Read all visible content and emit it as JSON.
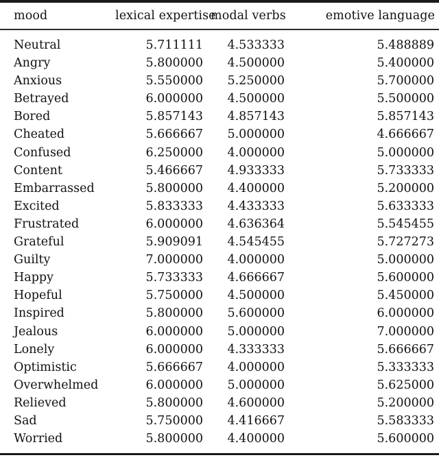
{
  "table": {
    "columns": [
      {
        "key": "mood",
        "label": "mood",
        "align": "left"
      },
      {
        "key": "lexical",
        "label": "lexical expertise",
        "align": "right"
      },
      {
        "key": "modal",
        "label": "modal verbs",
        "align": "right"
      },
      {
        "key": "emotive",
        "label": "emotive language",
        "align": "right"
      }
    ],
    "rows": [
      {
        "mood": "Neutral",
        "lexical": "5.711111",
        "modal": "4.533333",
        "emotive": "5.488889"
      },
      {
        "mood": "Angry",
        "lexical": "5.800000",
        "modal": "4.500000",
        "emotive": "5.400000"
      },
      {
        "mood": "Anxious",
        "lexical": "5.550000",
        "modal": "5.250000",
        "emotive": "5.700000"
      },
      {
        "mood": "Betrayed",
        "lexical": "6.000000",
        "modal": "4.500000",
        "emotive": "5.500000"
      },
      {
        "mood": "Bored",
        "lexical": "5.857143",
        "modal": "4.857143",
        "emotive": "5.857143"
      },
      {
        "mood": "Cheated",
        "lexical": "5.666667",
        "modal": "5.000000",
        "emotive": "4.666667"
      },
      {
        "mood": "Confused",
        "lexical": "6.250000",
        "modal": "4.000000",
        "emotive": "5.000000"
      },
      {
        "mood": "Content",
        "lexical": "5.466667",
        "modal": "4.933333",
        "emotive": "5.733333"
      },
      {
        "mood": "Embarrassed",
        "lexical": "5.800000",
        "modal": "4.400000",
        "emotive": "5.200000"
      },
      {
        "mood": "Excited",
        "lexical": "5.833333",
        "modal": "4.433333",
        "emotive": "5.633333"
      },
      {
        "mood": "Frustrated",
        "lexical": "6.000000",
        "modal": "4.636364",
        "emotive": "5.545455"
      },
      {
        "mood": "Grateful",
        "lexical": "5.909091",
        "modal": "4.545455",
        "emotive": "5.727273"
      },
      {
        "mood": "Guilty",
        "lexical": "7.000000",
        "modal": "4.000000",
        "emotive": "5.000000"
      },
      {
        "mood": "Happy",
        "lexical": "5.733333",
        "modal": "4.666667",
        "emotive": "5.600000"
      },
      {
        "mood": "Hopeful",
        "lexical": "5.750000",
        "modal": "4.500000",
        "emotive": "5.450000"
      },
      {
        "mood": "Inspired",
        "lexical": "5.800000",
        "modal": "5.600000",
        "emotive": "6.000000"
      },
      {
        "mood": "Jealous",
        "lexical": "6.000000",
        "modal": "5.000000",
        "emotive": "7.000000"
      },
      {
        "mood": "Lonely",
        "lexical": "6.000000",
        "modal": "4.333333",
        "emotive": "5.666667"
      },
      {
        "mood": "Optimistic",
        "lexical": "5.666667",
        "modal": "4.000000",
        "emotive": "5.333333"
      },
      {
        "mood": "Overwhelmed",
        "lexical": "6.000000",
        "modal": "5.000000",
        "emotive": "5.625000"
      },
      {
        "mood": "Relieved",
        "lexical": "5.800000",
        "modal": "4.600000",
        "emotive": "5.200000"
      },
      {
        "mood": "Sad",
        "lexical": "5.750000",
        "modal": "4.416667",
        "emotive": "5.583333"
      },
      {
        "mood": "Worried",
        "lexical": "5.800000",
        "modal": "4.400000",
        "emotive": "5.600000"
      }
    ]
  },
  "chart_data": {
    "type": "table",
    "title": "",
    "columns": [
      "mood",
      "lexical expertise",
      "modal verbs",
      "emotive language"
    ],
    "categories": [
      "Neutral",
      "Angry",
      "Anxious",
      "Betrayed",
      "Bored",
      "Cheated",
      "Confused",
      "Content",
      "Embarrassed",
      "Excited",
      "Frustrated",
      "Grateful",
      "Guilty",
      "Happy",
      "Hopeful",
      "Inspired",
      "Jealous",
      "Lonely",
      "Optimistic",
      "Overwhelmed",
      "Relieved",
      "Sad",
      "Worried"
    ],
    "series": [
      {
        "name": "lexical expertise",
        "values": [
          5.711111,
          5.8,
          5.55,
          6.0,
          5.857143,
          5.666667,
          6.25,
          5.466667,
          5.8,
          5.833333,
          6.0,
          5.909091,
          7.0,
          5.733333,
          5.75,
          5.8,
          6.0,
          6.0,
          5.666667,
          6.0,
          5.8,
          5.75,
          5.8
        ]
      },
      {
        "name": "modal verbs",
        "values": [
          4.533333,
          4.5,
          5.25,
          4.5,
          4.857143,
          5.0,
          4.0,
          4.933333,
          4.4,
          4.433333,
          4.636364,
          4.545455,
          4.0,
          4.666667,
          4.5,
          5.6,
          5.0,
          4.333333,
          4.0,
          5.0,
          4.6,
          4.416667,
          4.4
        ]
      },
      {
        "name": "emotive language",
        "values": [
          5.488889,
          5.4,
          5.7,
          5.5,
          5.857143,
          4.666667,
          5.0,
          5.733333,
          5.2,
          5.633333,
          5.545455,
          5.727273,
          5.0,
          5.6,
          5.45,
          6.0,
          7.0,
          5.666667,
          5.333333,
          5.625,
          5.2,
          5.583333,
          5.6
        ]
      }
    ]
  }
}
